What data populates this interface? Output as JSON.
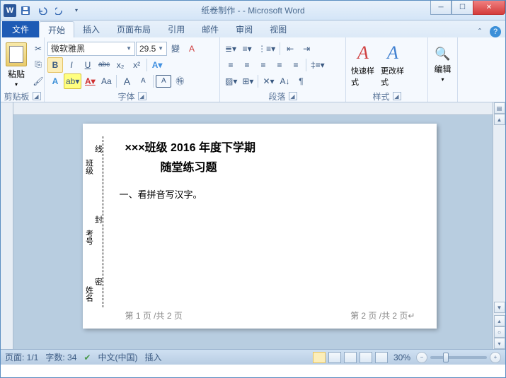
{
  "titlebar": {
    "title": "纸卷制作 - - Microsoft Word"
  },
  "tabs": {
    "file": "文件",
    "home": "开始",
    "insert": "插入",
    "layout": "页面布局",
    "ref": "引用",
    "mail": "邮件",
    "review": "审阅",
    "view": "视图"
  },
  "ribbon": {
    "clipboard": {
      "label": "剪贴板",
      "paste": "粘贴"
    },
    "font": {
      "label": "字体",
      "name": "微软雅黑",
      "size": "29.5",
      "ruby": "變",
      "clear": "A",
      "bold": "B",
      "italic": "I",
      "underline": "U",
      "strike": "abc",
      "sub": "x₂",
      "sup": "x²",
      "case": "Aa",
      "grow": "A",
      "shrink": "A"
    },
    "para": {
      "label": "段落"
    },
    "styles": {
      "label": "样式",
      "quick": "快速样式",
      "change": "更改样式"
    },
    "edit": {
      "label": "编辑"
    }
  },
  "doc": {
    "title": "×××班级 2016 年度下学期",
    "subtitle": "随堂练习题",
    "line1": "一、看拼音写汉字。",
    "v1": "班级",
    "v2": "考号",
    "v3": "姓名",
    "vb1": "线",
    "vb2": "封",
    "vb3": "密",
    "footL": "第 1 页 /共 2 页",
    "footR": "第 2 页 /共 2 页↵"
  },
  "status": {
    "page": "页面: 1/1",
    "words": "字数: 34",
    "lang": "中文(中国)",
    "mode": "插入",
    "zoom": "30%"
  }
}
